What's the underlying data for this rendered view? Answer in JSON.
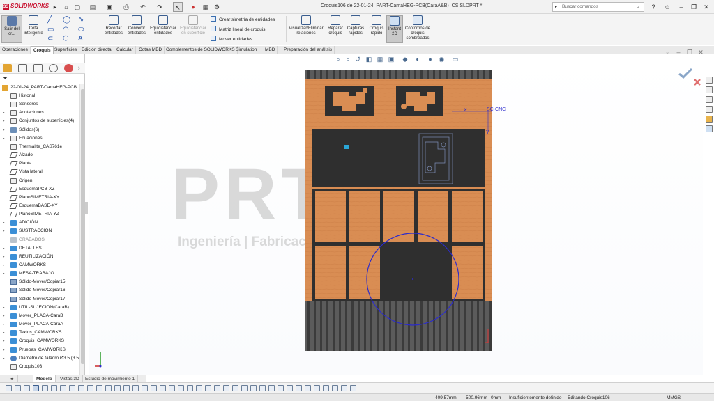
{
  "app": {
    "logo_text": "SOLIDWORKS",
    "doc_title": "Croquis106 de 22-01-24_PART-CamaHEG-PCB(CaraA&B)_CS.SLDPRT *"
  },
  "search": {
    "placeholder": "Buscar comandos"
  },
  "ribbon": {
    "exit_sketch": "Salir del cr...",
    "smart_dim": "Cota inteligente",
    "trim": "Recortar entidades",
    "convert": "Convertir entidades",
    "offset": "Equidistanciar entidades",
    "offset_surface": "Equidistanciar en superficie",
    "mirror": "Crear simetría de entidades",
    "linear_pattern": "Matriz lineal de croquis",
    "move": "Mover entidades",
    "relations": "Visualizar/Eliminar relaciones",
    "repair": "Reparar croquis",
    "quick_snaps": "Capturas rápidas",
    "rapid_sketch": "Croquis rápido",
    "instant2d": "Instant 2D",
    "shaded_contours": "Contornos de croquis sombreados"
  },
  "command_tabs": [
    "Operaciones",
    "Croquis",
    "Superficies",
    "Edición directa",
    "Calcular",
    "Cotas MBD",
    "Complementos de SOLIDWORKS",
    "Simulation",
    "MBD",
    "Preparación del análisis"
  ],
  "active_command_tab": "Croquis",
  "tree": {
    "root": "22-01-24_PART-CamaHEG-PCB",
    "items": [
      {
        "label": "Historial",
        "icon": "history-icon"
      },
      {
        "label": "Sensores",
        "icon": "sensor-icon"
      },
      {
        "label": "Anotaciones",
        "icon": "annotation-icon"
      },
      {
        "label": "Conjuntos de superficies(4)",
        "icon": "surface-icon"
      },
      {
        "label": "Sólidos(6)",
        "icon": "solid-icon"
      },
      {
        "label": "Ecuaciones",
        "icon": "equation-icon"
      },
      {
        "label": "Thermalite_CAS761e",
        "icon": "material-icon"
      },
      {
        "label": "Alzado",
        "icon": "plane-icon"
      },
      {
        "label": "Planta",
        "icon": "plane-icon"
      },
      {
        "label": "Vista lateral",
        "icon": "plane-icon"
      },
      {
        "label": "Origen",
        "icon": "origin-icon"
      },
      {
        "label": "EsquemaPCB-XZ",
        "icon": "plane-icon"
      },
      {
        "label": "PlanoSIMETRIA-XY",
        "icon": "plane-icon"
      },
      {
        "label": "EsquemaBASE-XY",
        "icon": "plane-icon"
      },
      {
        "label": "PlanoSIMETRIA-YZ",
        "icon": "plane-icon"
      },
      {
        "label": "ADICIÓN",
        "icon": "folder-icon"
      },
      {
        "label": "SUSTRACCIÓN",
        "icon": "folder-icon"
      },
      {
        "label": "GRABADOS",
        "icon": "folder-gray-icon"
      },
      {
        "label": "DETALLES",
        "icon": "folder-icon"
      },
      {
        "label": "REUTILIZACIÓN",
        "icon": "folder-icon"
      },
      {
        "label": "CAMWORKS",
        "icon": "folder-icon"
      },
      {
        "label": "MESA-TRABAJO",
        "icon": "folder-icon"
      },
      {
        "label": "Sólido-Mover/Copiar15",
        "icon": "feature-icon"
      },
      {
        "label": "Sólido-Mover/Copiar16",
        "icon": "feature-icon"
      },
      {
        "label": "Sólido-Mover/Copiar17",
        "icon": "feature-icon"
      },
      {
        "label": "UTIL-SUJECION(CaraB)",
        "icon": "folder-icon"
      },
      {
        "label": "Mover_PLACA-CaraB",
        "icon": "folder-icon"
      },
      {
        "label": "Mover_PLACA-CaraA",
        "icon": "folder-icon"
      },
      {
        "label": "Textos_CAMWORKS",
        "icon": "folder-icon"
      },
      {
        "label": "Croquis_CAMWORKS",
        "icon": "folder-icon"
      },
      {
        "label": "Pruebas_CAMWORKS",
        "icon": "folder-icon"
      },
      {
        "label": "Diámetro de taladro Ø3.5 (3.5)",
        "icon": "hole-icon"
      },
      {
        "label": "Croquis103",
        "icon": "sketch-icon"
      }
    ]
  },
  "bottom_tabs": [
    "Modelo",
    "Vistas 3D",
    "Estudio de movimiento 1"
  ],
  "active_bottom_tab": "Modelo",
  "status": {
    "x": "409.57mm",
    "y": "-500.96mm",
    "z": "0mm",
    "state": "Insuficientemente definido",
    "editing": "Editando Croquis106",
    "units": "MMGS"
  },
  "canvas": {
    "coord_label": "SC-CNC",
    "axis_x": "X",
    "axis_y": "Y",
    "watermark_logo": "PRTD",
    "watermark_text": "Ingeniería | Fabricación | Mantenimiento"
  },
  "colors": {
    "wood": "#d98d53",
    "board": "#2f2f2f",
    "rail": "#4a4a4a",
    "sketch_blue": "#2b2bcc",
    "accent_red": "#c8102e"
  }
}
